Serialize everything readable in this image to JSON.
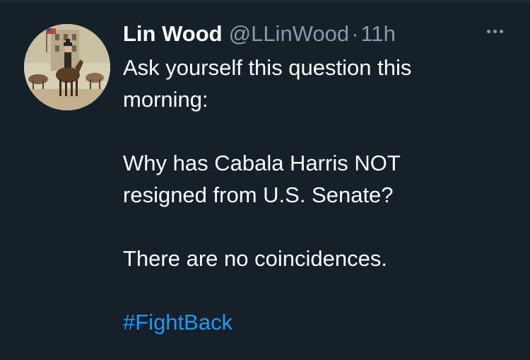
{
  "tweet": {
    "author": {
      "display_name": "Lin Wood",
      "handle": "@LLinWood",
      "separator": "·",
      "timestamp": "11h",
      "avatar_icon": "avatar-painting-horse-rider"
    },
    "more_icon": "more-horizontal-icon",
    "text": {
      "line1": "Ask yourself this question this",
      "line2": "morning:",
      "line3": "Why has Cabala Harris NOT",
      "line4": "resigned from U.S. Senate?",
      "line5": "There are no coincidences.",
      "hashtag": "#FightBack"
    },
    "colors": {
      "background": "#15202b",
      "text": "#ffffff",
      "secondary": "#8b98a5",
      "link": "#1d9bf0"
    }
  }
}
